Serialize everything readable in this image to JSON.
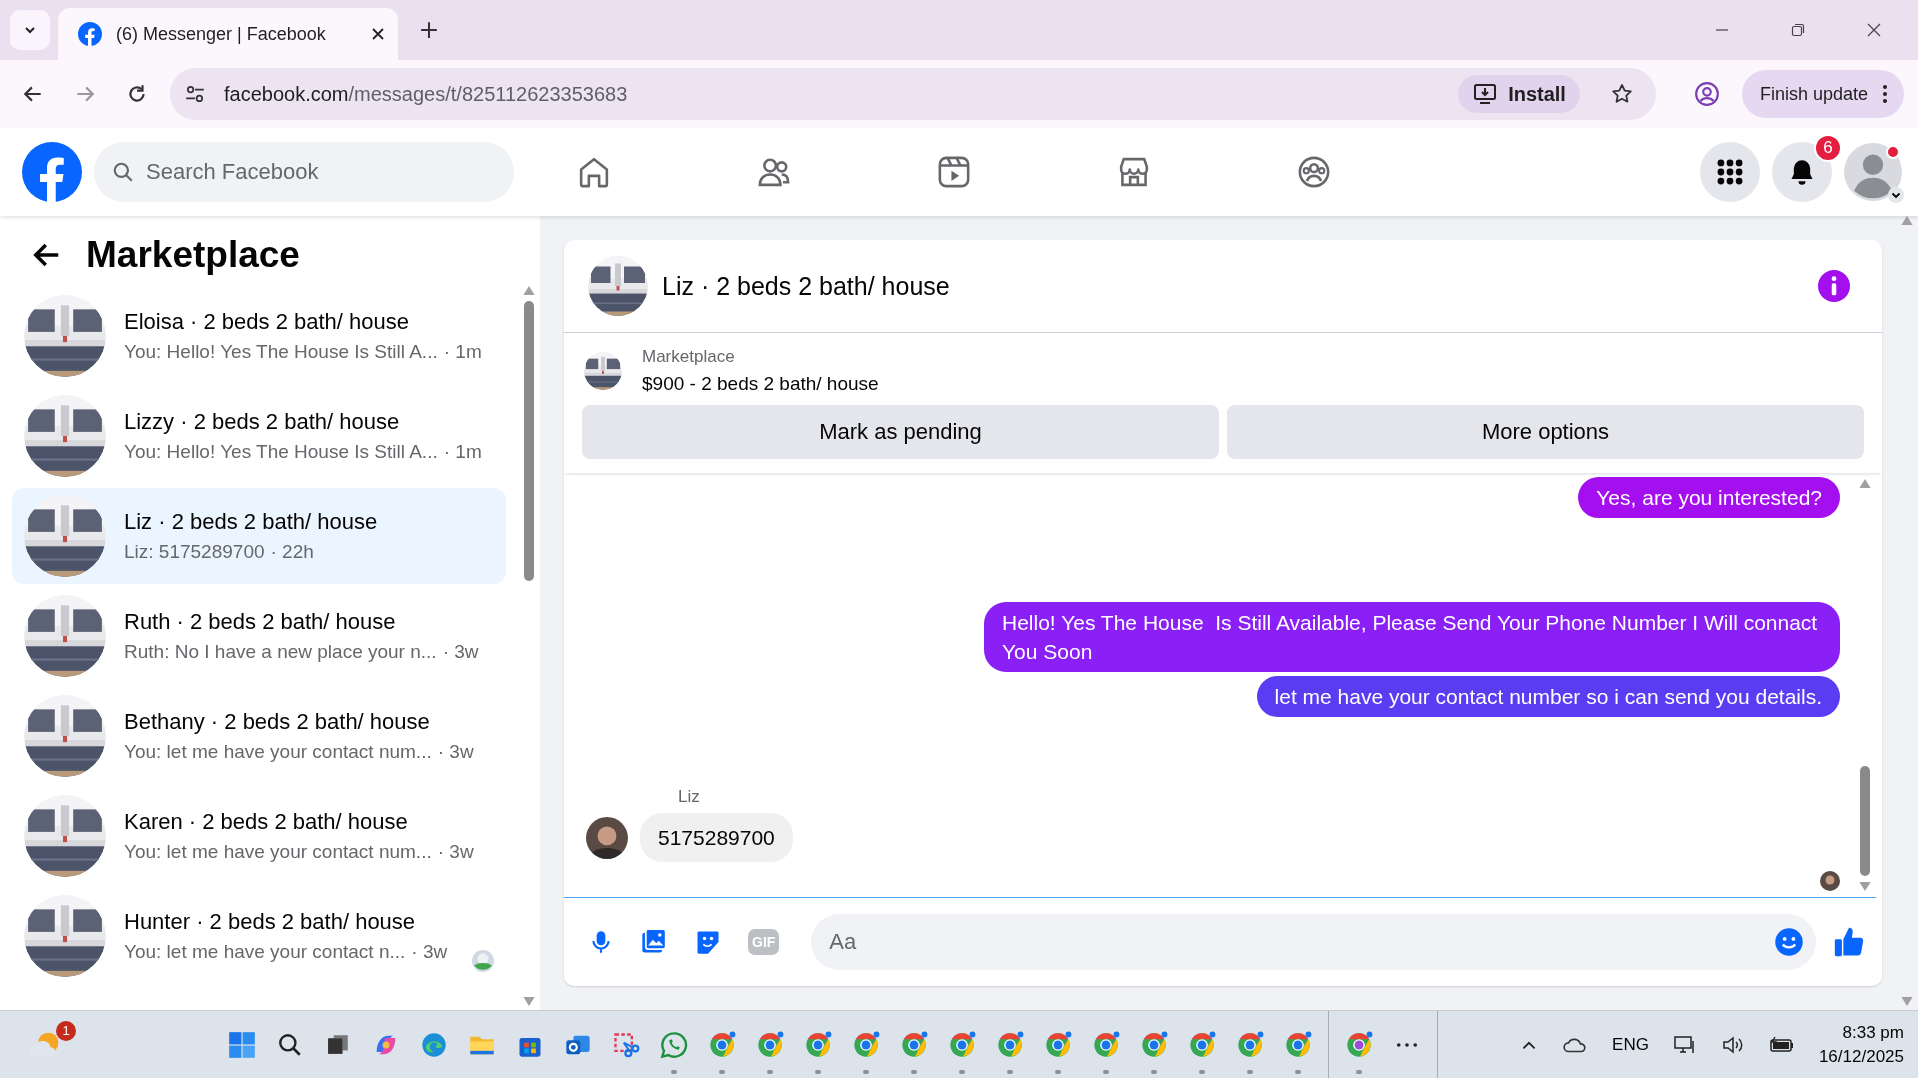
{
  "browser": {
    "tab_title": "(6) Messenger | Facebook",
    "url_host": "facebook.com",
    "url_path": "/messages/t/825112623353683",
    "install": "Install",
    "finish_update": "Finish update"
  },
  "facebook_header": {
    "search_placeholder": "Search Facebook",
    "notification_count": "6"
  },
  "sidebar": {
    "title": "Marketplace",
    "items": [
      {
        "name": "Eloisa · 2 beds 2 bath/ house",
        "preview": "You: Hello! Yes The House Is Still A...",
        "time": "· 1m",
        "selected": false,
        "seen": false
      },
      {
        "name": "Lizzy · 2 beds 2 bath/ house",
        "preview": "You: Hello! Yes The House Is Still A...",
        "time": "· 1m",
        "selected": false,
        "seen": false
      },
      {
        "name": "Liz · 2 beds 2 bath/ house",
        "preview": "Liz: 5175289700",
        "time": "· 22h",
        "selected": true,
        "seen": false
      },
      {
        "name": "Ruth · 2 beds 2 bath/ house",
        "preview": "Ruth: No I have a new place your n...",
        "time": "· 3w",
        "selected": false,
        "seen": false
      },
      {
        "name": "Bethany · 2 beds 2 bath/ house",
        "preview": "You: let me have your contact num...",
        "time": "· 3w",
        "selected": false,
        "seen": false
      },
      {
        "name": "Karen · 2 beds 2 bath/ house",
        "preview": "You: let me have your contact num...",
        "time": "· 3w",
        "selected": false,
        "seen": false
      },
      {
        "name": "Hunter · 2 beds 2 bath/ house",
        "preview": "You: let me have your contact n...",
        "time": "· 3w",
        "selected": false,
        "seen": true
      }
    ]
  },
  "chat": {
    "title": "Liz · 2 beds 2 bath/ house",
    "listing": {
      "source": "Marketplace",
      "title": "$900 - 2 beds 2 bath/ house"
    },
    "buttons": [
      "Mark as pending",
      "More options"
    ],
    "messages": [
      {
        "kind": "outgoing",
        "text": "Yes, are you interested?"
      },
      {
        "kind": "outgoing",
        "text": "Hello! Yes The House  Is Still Available, Please Send Your Phone Number I Will connact You Soon"
      },
      {
        "kind": "outgoing",
        "text": "let me have your contact number so i can send you details."
      },
      {
        "kind": "incoming",
        "sender": "Liz",
        "text": "5175289700"
      }
    ],
    "composer": {
      "placeholder": "Aa",
      "gif_label": "GIF"
    }
  },
  "taskbar": {
    "weather_badge": "1",
    "language": "ENG",
    "time": "8:33 pm",
    "date": "16/12/2025"
  }
}
